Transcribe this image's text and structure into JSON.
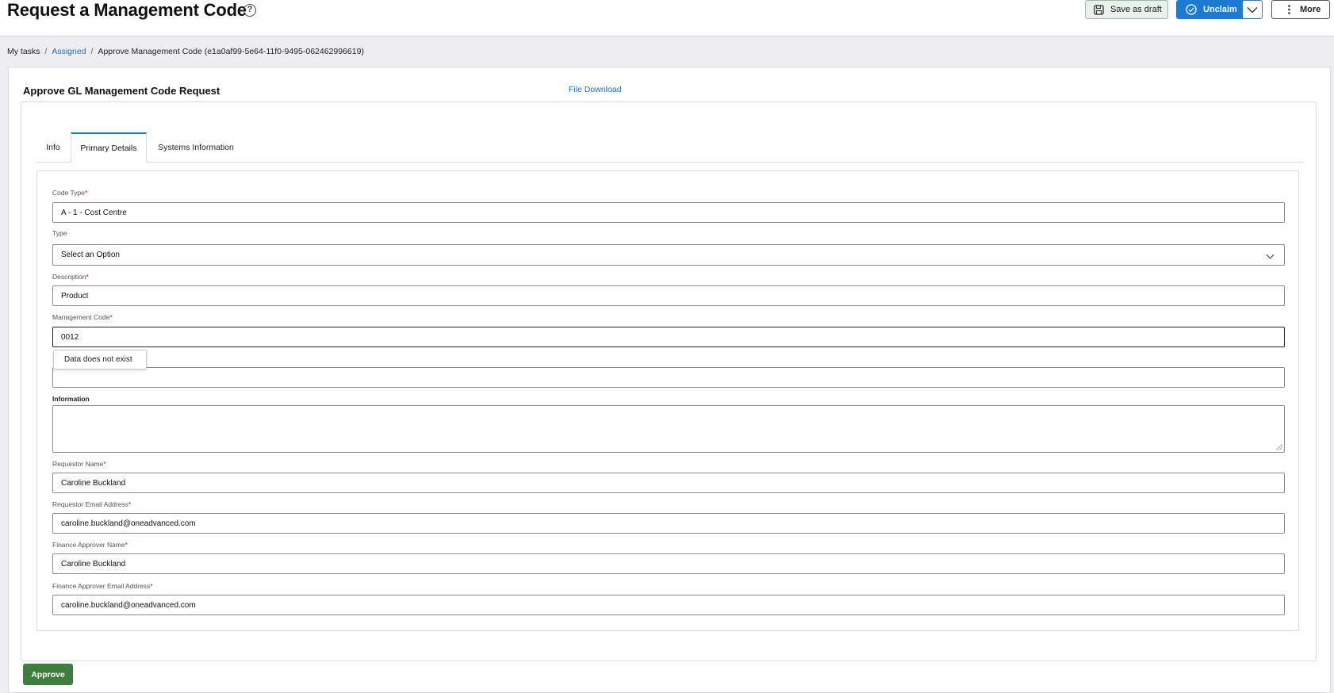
{
  "header": {
    "title": "Request a Management Code",
    "help_icon": "question-circle-icon",
    "save_draft_label": "Save as draft",
    "unclaim_label": "Unclaim",
    "more_label": "More"
  },
  "breadcrumb": {
    "items": [
      "My tasks",
      "Assigned",
      "Approve Management Code (e1a0af99-5e64-11f0-9495-062462996619)"
    ]
  },
  "card": {
    "title": "Approve GL Management Code Request",
    "file_download": "File Download"
  },
  "tabs": [
    {
      "label": "Info",
      "active": false
    },
    {
      "label": "Primary Details",
      "active": true
    },
    {
      "label": "Systems Information",
      "active": false
    }
  ],
  "form": {
    "code_type": {
      "label": "Code Type",
      "value": "A - 1 - Cost Centre"
    },
    "type": {
      "label": "Type",
      "value": "Select an Option"
    },
    "description": {
      "label": "Description",
      "value": "Product"
    },
    "management_code": {
      "label": "Management Code",
      "value": "0012"
    },
    "hidden_field": {
      "value": ""
    },
    "information": {
      "label": "Information",
      "value": ""
    },
    "requestor_name": {
      "label": "Requestor Name",
      "value": "Caroline Buckland"
    },
    "requestor_email": {
      "label": "Requestor Email Address",
      "value": "caroline.buckland@oneadvanced.com"
    },
    "finance_approver_name": {
      "label": "Finance Approver Name",
      "value": "Caroline Buckland"
    },
    "finance_approver_email": {
      "label": "Finance Approver Email Address",
      "value": "caroline.buckland@oneadvanced.com"
    }
  },
  "tooltip": {
    "text": "Data does not exist"
  },
  "actions": {
    "approve_label": "Approve"
  },
  "colors": {
    "primary_blue": "#1a7ad4",
    "approve_green": "#3f7d3c",
    "required_red": "#c41a1a"
  }
}
